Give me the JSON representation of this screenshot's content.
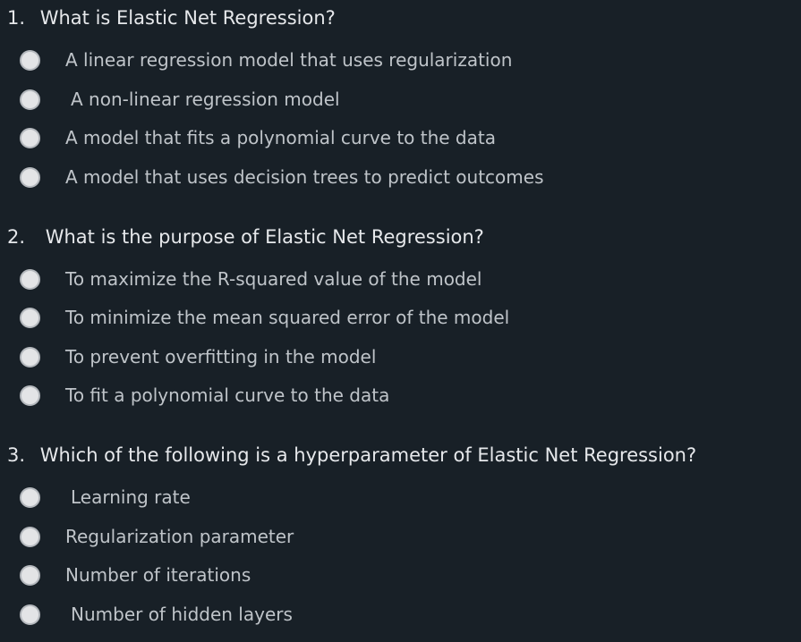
{
  "questions": [
    {
      "number": "1.",
      "text": "What is Elastic Net Regression?",
      "options": [
        "A linear regression model that uses regularization",
        "A non-linear regression model",
        "A model that fits a polynomial curve to the data",
        "A model that uses decision trees to predict outcomes"
      ]
    },
    {
      "number": "2.",
      "text": "What is the purpose of Elastic Net Regression?",
      "options": [
        "To maximize the R-squared value of the model",
        "To minimize the mean squared error of the model",
        "To prevent overfitting in the model",
        "To fit a polynomial curve to the data"
      ]
    },
    {
      "number": "3.",
      "text": "Which of the following is a hyperparameter of Elastic Net Regression?",
      "options": [
        "Learning rate",
        "Regularization parameter",
        "Number of iterations",
        "Number of hidden layers"
      ]
    }
  ]
}
